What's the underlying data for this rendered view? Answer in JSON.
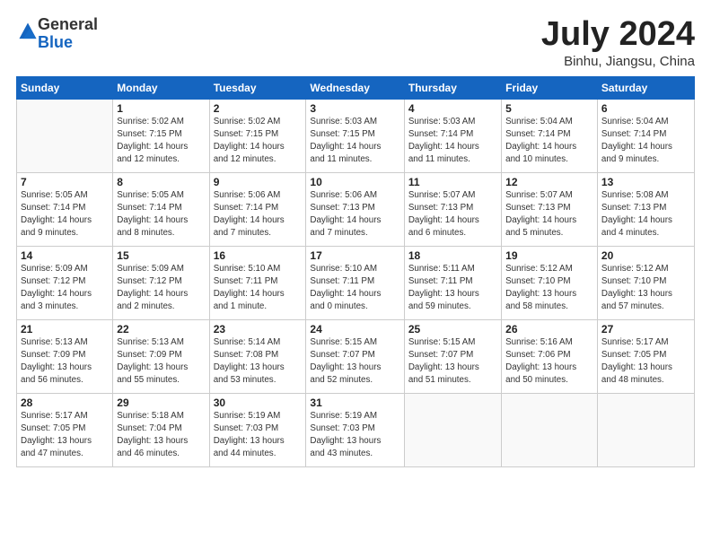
{
  "header": {
    "logo_general": "General",
    "logo_blue": "Blue",
    "month_title": "July 2024",
    "location": "Binhu, Jiangsu, China"
  },
  "days_of_week": [
    "Sunday",
    "Monday",
    "Tuesday",
    "Wednesday",
    "Thursday",
    "Friday",
    "Saturday"
  ],
  "weeks": [
    [
      {
        "day": "",
        "info": ""
      },
      {
        "day": "1",
        "info": "Sunrise: 5:02 AM\nSunset: 7:15 PM\nDaylight: 14 hours\nand 12 minutes."
      },
      {
        "day": "2",
        "info": "Sunrise: 5:02 AM\nSunset: 7:15 PM\nDaylight: 14 hours\nand 12 minutes."
      },
      {
        "day": "3",
        "info": "Sunrise: 5:03 AM\nSunset: 7:15 PM\nDaylight: 14 hours\nand 11 minutes."
      },
      {
        "day": "4",
        "info": "Sunrise: 5:03 AM\nSunset: 7:14 PM\nDaylight: 14 hours\nand 11 minutes."
      },
      {
        "day": "5",
        "info": "Sunrise: 5:04 AM\nSunset: 7:14 PM\nDaylight: 14 hours\nand 10 minutes."
      },
      {
        "day": "6",
        "info": "Sunrise: 5:04 AM\nSunset: 7:14 PM\nDaylight: 14 hours\nand 9 minutes."
      }
    ],
    [
      {
        "day": "7",
        "info": "Sunrise: 5:05 AM\nSunset: 7:14 PM\nDaylight: 14 hours\nand 9 minutes."
      },
      {
        "day": "8",
        "info": "Sunrise: 5:05 AM\nSunset: 7:14 PM\nDaylight: 14 hours\nand 8 minutes."
      },
      {
        "day": "9",
        "info": "Sunrise: 5:06 AM\nSunset: 7:14 PM\nDaylight: 14 hours\nand 7 minutes."
      },
      {
        "day": "10",
        "info": "Sunrise: 5:06 AM\nSunset: 7:13 PM\nDaylight: 14 hours\nand 7 minutes."
      },
      {
        "day": "11",
        "info": "Sunrise: 5:07 AM\nSunset: 7:13 PM\nDaylight: 14 hours\nand 6 minutes."
      },
      {
        "day": "12",
        "info": "Sunrise: 5:07 AM\nSunset: 7:13 PM\nDaylight: 14 hours\nand 5 minutes."
      },
      {
        "day": "13",
        "info": "Sunrise: 5:08 AM\nSunset: 7:13 PM\nDaylight: 14 hours\nand 4 minutes."
      }
    ],
    [
      {
        "day": "14",
        "info": "Sunrise: 5:09 AM\nSunset: 7:12 PM\nDaylight: 14 hours\nand 3 minutes."
      },
      {
        "day": "15",
        "info": "Sunrise: 5:09 AM\nSunset: 7:12 PM\nDaylight: 14 hours\nand 2 minutes."
      },
      {
        "day": "16",
        "info": "Sunrise: 5:10 AM\nSunset: 7:11 PM\nDaylight: 14 hours\nand 1 minute."
      },
      {
        "day": "17",
        "info": "Sunrise: 5:10 AM\nSunset: 7:11 PM\nDaylight: 14 hours\nand 0 minutes."
      },
      {
        "day": "18",
        "info": "Sunrise: 5:11 AM\nSunset: 7:11 PM\nDaylight: 13 hours\nand 59 minutes."
      },
      {
        "day": "19",
        "info": "Sunrise: 5:12 AM\nSunset: 7:10 PM\nDaylight: 13 hours\nand 58 minutes."
      },
      {
        "day": "20",
        "info": "Sunrise: 5:12 AM\nSunset: 7:10 PM\nDaylight: 13 hours\nand 57 minutes."
      }
    ],
    [
      {
        "day": "21",
        "info": "Sunrise: 5:13 AM\nSunset: 7:09 PM\nDaylight: 13 hours\nand 56 minutes."
      },
      {
        "day": "22",
        "info": "Sunrise: 5:13 AM\nSunset: 7:09 PM\nDaylight: 13 hours\nand 55 minutes."
      },
      {
        "day": "23",
        "info": "Sunrise: 5:14 AM\nSunset: 7:08 PM\nDaylight: 13 hours\nand 53 minutes."
      },
      {
        "day": "24",
        "info": "Sunrise: 5:15 AM\nSunset: 7:07 PM\nDaylight: 13 hours\nand 52 minutes."
      },
      {
        "day": "25",
        "info": "Sunrise: 5:15 AM\nSunset: 7:07 PM\nDaylight: 13 hours\nand 51 minutes."
      },
      {
        "day": "26",
        "info": "Sunrise: 5:16 AM\nSunset: 7:06 PM\nDaylight: 13 hours\nand 50 minutes."
      },
      {
        "day": "27",
        "info": "Sunrise: 5:17 AM\nSunset: 7:05 PM\nDaylight: 13 hours\nand 48 minutes."
      }
    ],
    [
      {
        "day": "28",
        "info": "Sunrise: 5:17 AM\nSunset: 7:05 PM\nDaylight: 13 hours\nand 47 minutes."
      },
      {
        "day": "29",
        "info": "Sunrise: 5:18 AM\nSunset: 7:04 PM\nDaylight: 13 hours\nand 46 minutes."
      },
      {
        "day": "30",
        "info": "Sunrise: 5:19 AM\nSunset: 7:03 PM\nDaylight: 13 hours\nand 44 minutes."
      },
      {
        "day": "31",
        "info": "Sunrise: 5:19 AM\nSunset: 7:03 PM\nDaylight: 13 hours\nand 43 minutes."
      },
      {
        "day": "",
        "info": ""
      },
      {
        "day": "",
        "info": ""
      },
      {
        "day": "",
        "info": ""
      }
    ]
  ]
}
